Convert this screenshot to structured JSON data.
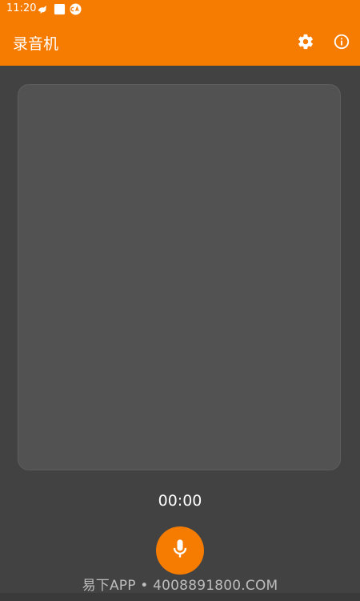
{
  "status_bar": {
    "time": "11:20",
    "icons": [
      "notification-bird-icon",
      "square-icon",
      "ca-badge-icon"
    ]
  },
  "app_bar": {
    "title": "录音机",
    "actions": [
      "settings-icon",
      "info-icon"
    ]
  },
  "recorder": {
    "timer": "00:00",
    "record_button_icon": "microphone-icon"
  },
  "watermark": {
    "text": "易下APP • 4008891800.COM"
  },
  "colors": {
    "accent": "#f57c00",
    "background": "#424242",
    "panel": "#525252"
  }
}
